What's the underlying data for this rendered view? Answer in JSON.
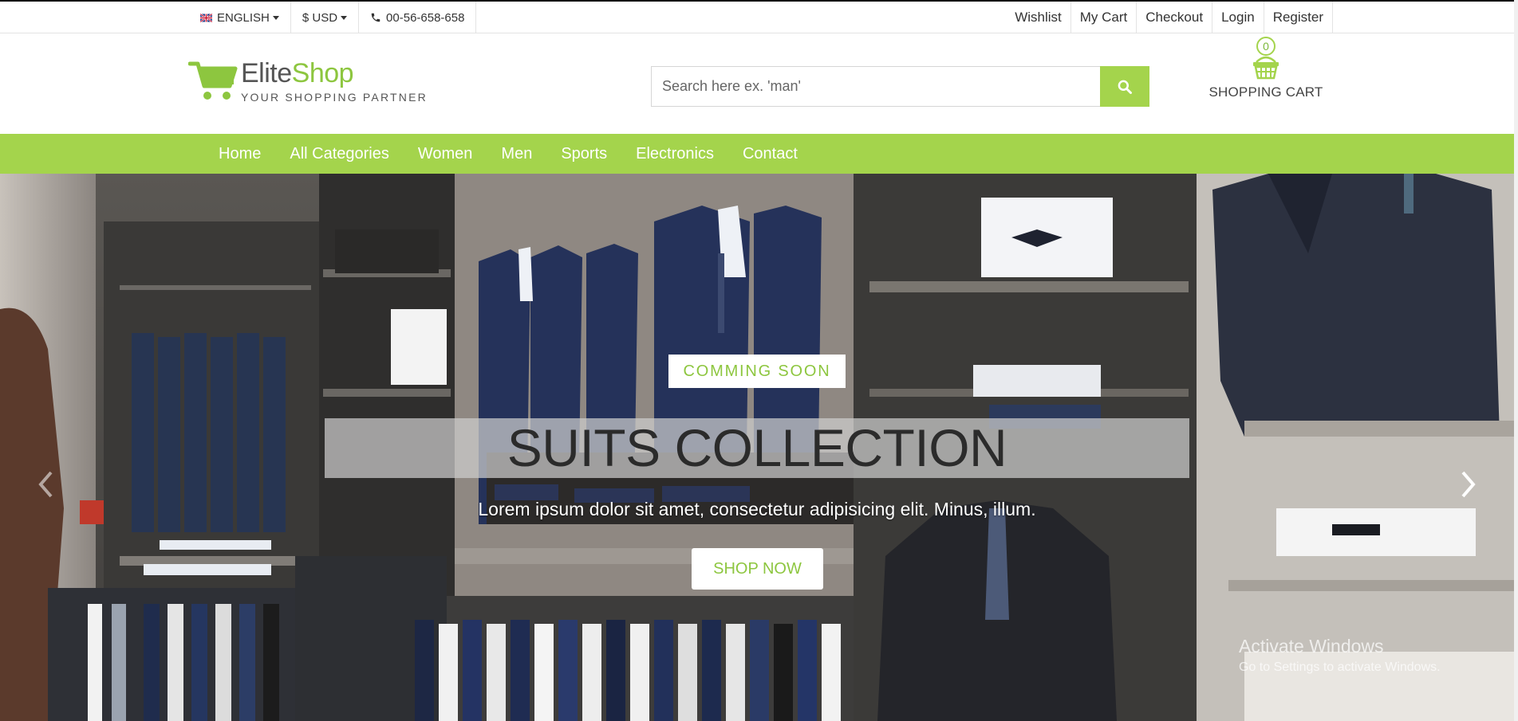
{
  "topbar": {
    "language": "ENGLISH",
    "currency": "$ USD",
    "phone": "00-56-658-658",
    "links": [
      "Wishlist",
      "My Cart",
      "Checkout",
      "Login",
      "Register"
    ]
  },
  "header": {
    "logo_part1": "Elite",
    "logo_part2": "Shop",
    "tagline": "YOUR SHOPPING PARTNER",
    "search_placeholder": "Search here ex. 'man'",
    "cart_count": "0",
    "cart_label": "SHOPPING CART"
  },
  "nav": {
    "items": [
      "Home",
      "All Categories",
      "Women",
      "Men",
      "Sports",
      "Electronics",
      "Contact"
    ]
  },
  "hero": {
    "badge": "COMMING SOON",
    "title": "SUITS COLLECTION",
    "subtitle": "Lorem ipsum dolor sit amet, consectetur adipisicing elit. Minus, illum.",
    "button": "SHOP NOW"
  },
  "watermark": {
    "line1": "Activate Windows",
    "line2": "Go to Settings to activate Windows."
  },
  "colors": {
    "accent": "#a4d44c",
    "accent_text": "#8dc63f"
  },
  "icons": [
    "uk-flag-icon",
    "caret-down-icon",
    "phone-icon",
    "cart-logo-icon",
    "search-icon",
    "basket-icon",
    "chevron-left-icon",
    "chevron-right-icon"
  ]
}
